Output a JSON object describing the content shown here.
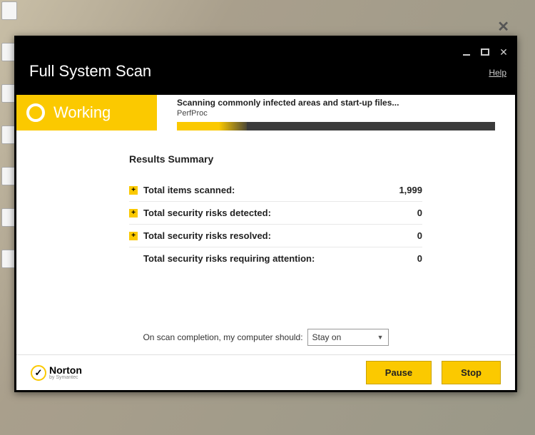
{
  "window": {
    "title": "Full System Scan",
    "help": "Help"
  },
  "status": {
    "label": "Working",
    "message": "Scanning commonly infected areas and start-up files...",
    "current_file": "PerfProc"
  },
  "summary": {
    "title": "Results Summary",
    "rows": [
      {
        "label": "Total items scanned:",
        "value": "1,999",
        "expand": true
      },
      {
        "label": "Total security risks detected:",
        "value": "0",
        "expand": true
      },
      {
        "label": "Total security risks resolved:",
        "value": "0",
        "expand": true
      },
      {
        "label": "Total security risks requiring attention:",
        "value": "0",
        "expand": false
      }
    ]
  },
  "completion": {
    "label": "On scan completion, my computer should:",
    "selected": "Stay on"
  },
  "brand": {
    "name": "Norton",
    "by": "by Symantec"
  },
  "buttons": {
    "pause": "Pause",
    "stop": "Stop"
  }
}
